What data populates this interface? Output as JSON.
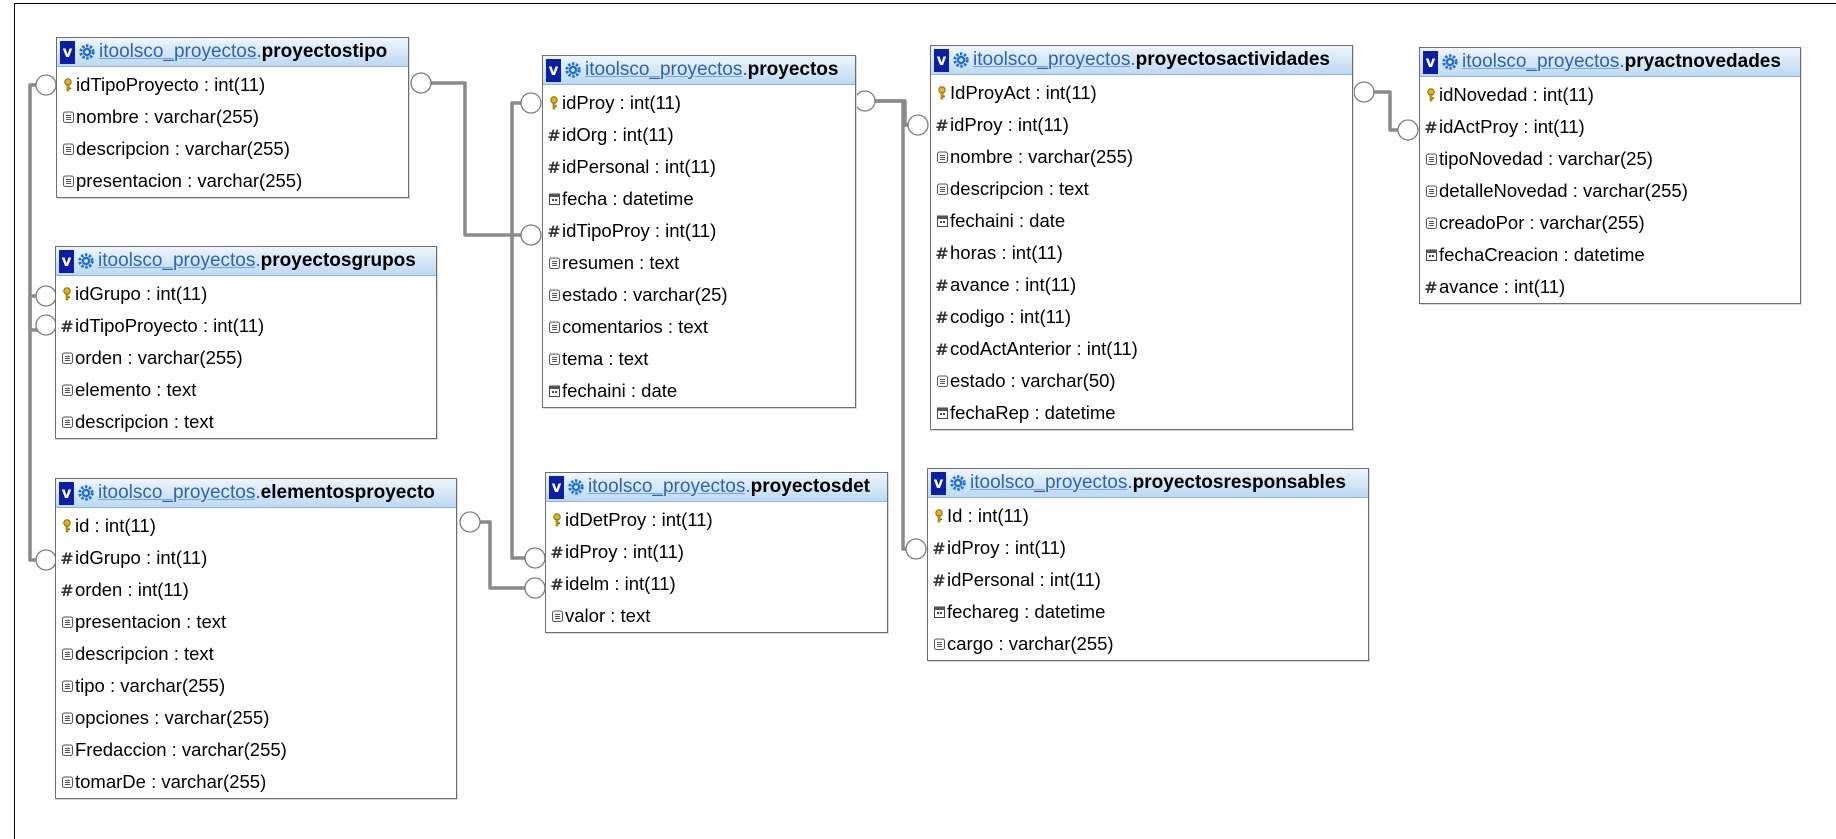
{
  "tables": [
    {
      "id": "proyectostipo",
      "schema": "itoolsco_proyectos",
      "name": "proyectostipo",
      "columns": [
        {
          "text": "idTipoProyecto : int(11)",
          "icon": "key"
        },
        {
          "text": "nombre : varchar(255)",
          "icon": "text"
        },
        {
          "text": "descripcion : varchar(255)",
          "icon": "text"
        },
        {
          "text": "presentacion : varchar(255)",
          "icon": "text"
        }
      ]
    },
    {
      "id": "proyectosgrupos",
      "schema": "itoolsco_proyectos",
      "name": "proyectosgrupos",
      "columns": [
        {
          "text": "idGrupo : int(11)",
          "icon": "key"
        },
        {
          "text": "idTipoProyecto : int(11)",
          "icon": "number"
        },
        {
          "text": "orden : varchar(255)",
          "icon": "text"
        },
        {
          "text": "elemento : text",
          "icon": "text"
        },
        {
          "text": "descripcion : text",
          "icon": "text"
        }
      ]
    },
    {
      "id": "elementosproyecto",
      "schema": "itoolsco_proyectos",
      "name": "elementosproyecto",
      "columns": [
        {
          "text": "id : int(11)",
          "icon": "key"
        },
        {
          "text": "idGrupo : int(11)",
          "icon": "number"
        },
        {
          "text": "orden : int(11)",
          "icon": "number"
        },
        {
          "text": "presentacion : text",
          "icon": "text"
        },
        {
          "text": "descripcion : text",
          "icon": "text"
        },
        {
          "text": "tipo : varchar(255)",
          "icon": "text"
        },
        {
          "text": "opciones : varchar(255)",
          "icon": "text"
        },
        {
          "text": "Fredaccion : varchar(255)",
          "icon": "text"
        },
        {
          "text": "tomarDe : varchar(255)",
          "icon": "text"
        }
      ]
    },
    {
      "id": "proyectos",
      "schema": "itoolsco_proyectos",
      "name": "proyectos",
      "columns": [
        {
          "text": "idProy : int(11)",
          "icon": "key"
        },
        {
          "text": "idOrg : int(11)",
          "icon": "number"
        },
        {
          "text": "idPersonal : int(11)",
          "icon": "number"
        },
        {
          "text": "fecha : datetime",
          "icon": "date"
        },
        {
          "text": "idTipoProy : int(11)",
          "icon": "number"
        },
        {
          "text": "resumen : text",
          "icon": "text"
        },
        {
          "text": "estado : varchar(25)",
          "icon": "text"
        },
        {
          "text": "comentarios : text",
          "icon": "text"
        },
        {
          "text": "tema : text",
          "icon": "text"
        },
        {
          "text": "fechaini : date",
          "icon": "date"
        }
      ]
    },
    {
      "id": "proyectosdet",
      "schema": "itoolsco_proyectos",
      "name": "proyectosdet",
      "columns": [
        {
          "text": "idDetProy : int(11)",
          "icon": "key"
        },
        {
          "text": "idProy : int(11)",
          "icon": "number"
        },
        {
          "text": "idelm : int(11)",
          "icon": "number"
        },
        {
          "text": "valor : text",
          "icon": "text"
        }
      ]
    },
    {
      "id": "proyectosactividades",
      "schema": "itoolsco_proyectos",
      "name": "proyectosactividades",
      "columns": [
        {
          "text": "IdProyAct : int(11)",
          "icon": "key"
        },
        {
          "text": "idProy : int(11)",
          "icon": "number"
        },
        {
          "text": "nombre : varchar(255)",
          "icon": "text"
        },
        {
          "text": "descripcion : text",
          "icon": "text"
        },
        {
          "text": "fechaini : date",
          "icon": "date"
        },
        {
          "text": "horas : int(11)",
          "icon": "number"
        },
        {
          "text": "avance : int(11)",
          "icon": "number"
        },
        {
          "text": "codigo : int(11)",
          "icon": "number"
        },
        {
          "text": "codActAnterior : int(11)",
          "icon": "number"
        },
        {
          "text": "estado : varchar(50)",
          "icon": "text"
        },
        {
          "text": "fechaRep : datetime",
          "icon": "date"
        }
      ]
    },
    {
      "id": "proyectosresponsables",
      "schema": "itoolsco_proyectos",
      "name": "proyectosresponsables",
      "columns": [
        {
          "text": "Id : int(11)",
          "icon": "key"
        },
        {
          "text": "idProy : int(11)",
          "icon": "number"
        },
        {
          "text": "idPersonal : int(11)",
          "icon": "number"
        },
        {
          "text": "fechareg : datetime",
          "icon": "date"
        },
        {
          "text": "cargo : varchar(255)",
          "icon": "text"
        }
      ]
    },
    {
      "id": "pryactnovedades",
      "schema": "itoolsco_proyectos",
      "name": "pryactnovedades",
      "columns": [
        {
          "text": "idNovedad : int(11)",
          "icon": "key"
        },
        {
          "text": "idActProy : int(11)",
          "icon": "number"
        },
        {
          "text": "tipoNovedad : varchar(25)",
          "icon": "text"
        },
        {
          "text": "detalleNovedad : varchar(255)",
          "icon": "text"
        },
        {
          "text": "creadoPor : varchar(255)",
          "icon": "text"
        },
        {
          "text": "fechaCreacion : datetime",
          "icon": "date"
        },
        {
          "text": "avance : int(11)",
          "icon": "number"
        }
      ]
    }
  ],
  "relations": [
    {
      "from": "proyectostipo.idTipoProyecto",
      "to": "proyectosgrupos.idTipoProyecto"
    },
    {
      "from": "proyectosgrupos.idGrupo",
      "to": "elementosproyecto.idGrupo"
    },
    {
      "from": "proyectostipo.idTipoProyecto",
      "to": "proyectos.idTipoProy"
    },
    {
      "from": "proyectos.idProy",
      "to": "proyectosdet.idProy"
    },
    {
      "from": "elementosproyecto.id",
      "to": "proyectosdet.idelm"
    },
    {
      "from": "proyectos.idProy",
      "to": "proyectosactividades.idProy"
    },
    {
      "from": "proyectos.idProy",
      "to": "proyectosresponsables.idProy"
    },
    {
      "from": "proyectosactividades.IdProyAct",
      "to": "pryactnovedades.idActProy"
    }
  ],
  "colors": {
    "header_gradient_top": "#eef6fd",
    "header_gradient_bottom": "#bcd9f3",
    "schema_text": "#2f63ad",
    "v_badge": "#0b1fa0",
    "connector_line": "#8a8a8a"
  }
}
